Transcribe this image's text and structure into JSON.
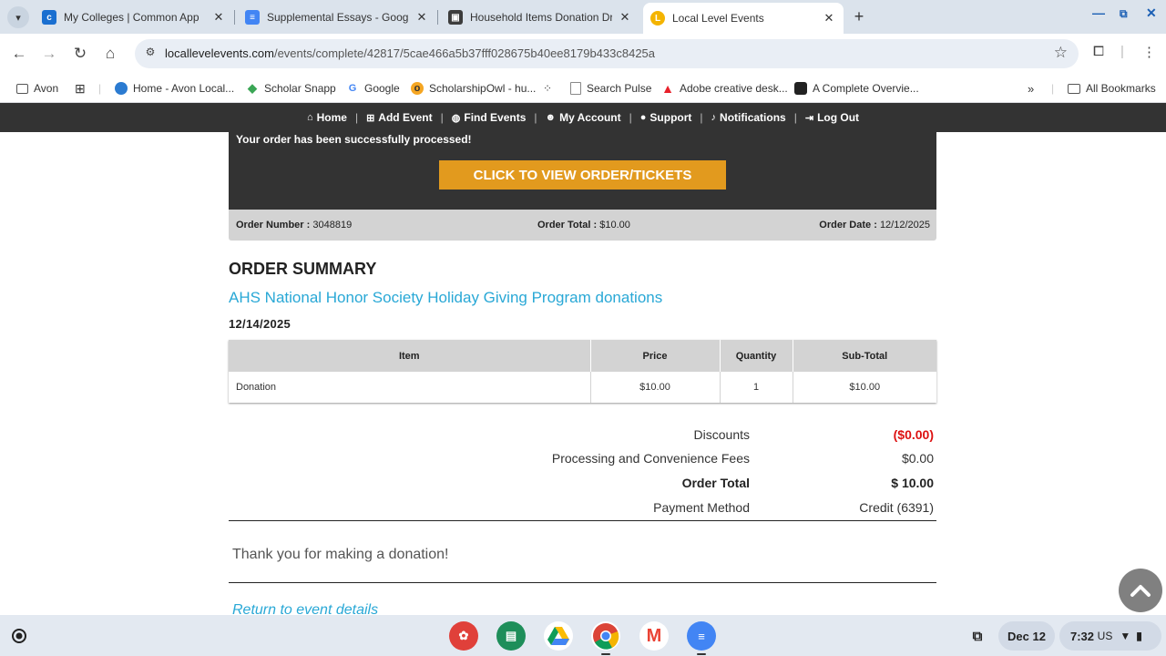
{
  "browser": {
    "tabs": [
      {
        "title": "My Colleges | Common App",
        "icon": "common-app-icon",
        "active": false
      },
      {
        "title": "Supplemental Essays - Google",
        "icon": "google-docs-icon",
        "active": false
      },
      {
        "title": "Household Items Donation Driv",
        "icon": "calendar-image-icon",
        "active": false
      },
      {
        "title": "Local Level Events",
        "icon": "local-level-events-icon",
        "active": true
      }
    ],
    "url_domain": "locallevelevents.com",
    "url_path": "/events/complete/42817/5cae466a5b37fff028675b40ee8179b433c8425a",
    "bookmarks": [
      {
        "label": "Avon",
        "icon": "folder-icon"
      },
      {
        "label": "Home - Avon Local...",
        "icon": "globe-icon"
      },
      {
        "label": "Scholar Snapp",
        "icon": "diamond-icon"
      },
      {
        "label": "Google",
        "icon": "google-icon"
      },
      {
        "label": "ScholarshipOwl - hu...",
        "icon": "owl-icon"
      },
      {
        "label": "Search Pulse",
        "icon": "document-icon"
      },
      {
        "label": "Adobe creative desk...",
        "icon": "adobe-icon"
      },
      {
        "label": "A Complete Overvie...",
        "icon": "shield-icon"
      }
    ],
    "all_bookmarks": "All Bookmarks",
    "overflow": "»"
  },
  "site_nav": [
    {
      "label": "Home",
      "icon": "home-icon"
    },
    {
      "label": "Add Event",
      "icon": "plus-square-icon"
    },
    {
      "label": "Find Events",
      "icon": "globe-icon"
    },
    {
      "label": "My Account",
      "icon": "user-icon"
    },
    {
      "label": "Support",
      "icon": "chat-icon"
    },
    {
      "label": "Notifications",
      "icon": "bell-icon"
    },
    {
      "label": "Log Out",
      "icon": "logout-icon"
    }
  ],
  "confirmation": {
    "message": "Your order has been successfully processed!",
    "button_label": "CLICK TO VIEW ORDER/TICKETS",
    "order_number_label": "Order Number :",
    "order_number": "3048819",
    "order_total_label": "Order Total :",
    "order_total": "$10.00",
    "order_date_label": "Order Date :",
    "order_date": "12/12/2025"
  },
  "summary": {
    "heading": "ORDER SUMMARY",
    "event_title": "AHS National Honor Society Holiday Giving Program donations",
    "event_date": "12/14/2025",
    "columns": [
      "Item",
      "Price",
      "Quantity",
      "Sub-Total"
    ],
    "rows": [
      [
        "Donation",
        "$10.00",
        "1",
        "$10.00"
      ]
    ],
    "totals": {
      "discounts_label": "Discounts",
      "discounts_value": "($0.00)",
      "fees_label": "Processing and Convenience Fees",
      "fees_value": "$0.00",
      "order_total_label": "Order Total",
      "order_total_value": "$ 10.00",
      "payment_label": "Payment Method",
      "payment_value": "Credit (6391)"
    },
    "thanks": "Thank you for making a donation!",
    "return_link": "Return to event details"
  },
  "shelf": {
    "date": "Dec 12",
    "time": "7:32",
    "locale": "US",
    "apps": [
      "canvas-icon",
      "classroom-icon",
      "drive-icon",
      "chrome-icon",
      "gmail-icon",
      "docs-icon"
    ]
  },
  "colors": {
    "accent_orange": "#e29a1e",
    "link_blue": "#29a8d6",
    "dark_panel": "#333333",
    "discount_red": "#dd1111"
  }
}
